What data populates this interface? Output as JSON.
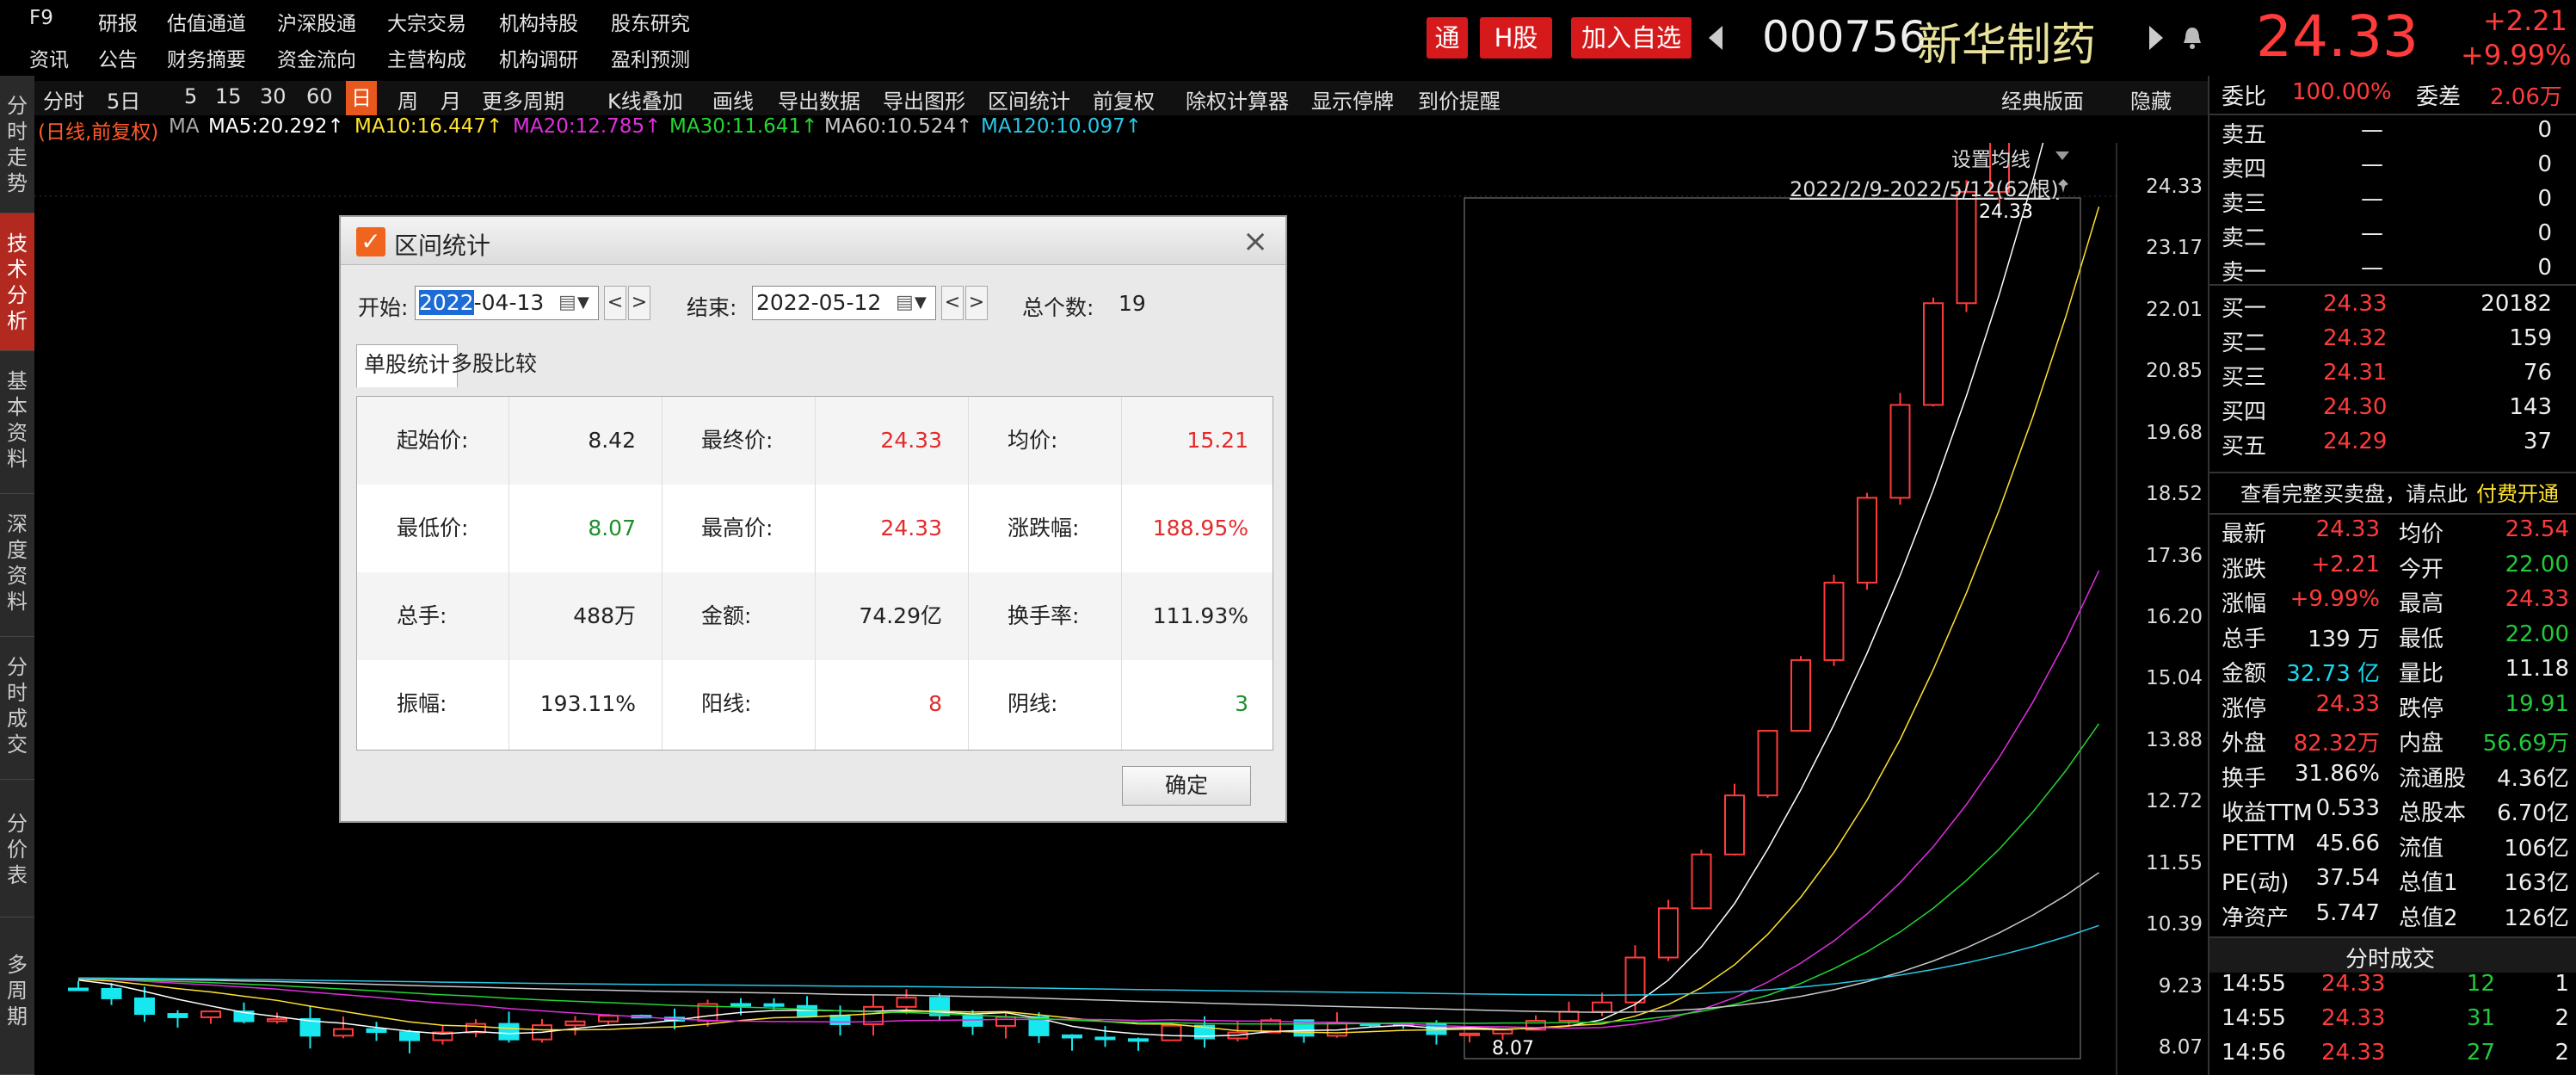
{
  "top_menu": {
    "row1": [
      "F9",
      "研报",
      "估值通道",
      "沪深股通",
      "大宗交易",
      "机构持股",
      "股东研究"
    ],
    "row2": [
      "资讯",
      "公告",
      "财务摘要",
      "资金流向",
      "主营构成",
      "机构调研",
      "盈利预测"
    ]
  },
  "header": {
    "tong_label": "通",
    "h_share_label": "H股",
    "add_watch_label": "加入自选",
    "code": "000756",
    "name": "新华制药",
    "price": "24.33",
    "change": "+2.21",
    "change_pct": "+9.99%",
    "prev_icon": "triangle-left-icon",
    "next_icon": "triangle-right-icon",
    "bell_icon": "bell-icon"
  },
  "left_tabs": [
    "分时走势",
    "技术分析",
    "基本资料",
    "深度资料",
    "分时成交",
    "分价表",
    "多周期"
  ],
  "toolbar": {
    "items": [
      "分时",
      "5日",
      "5",
      "15",
      "30",
      "60",
      "日",
      "周",
      "月",
      "更多周期",
      "K线叠加",
      "画线",
      "导出数据",
      "导出图形",
      "区间统计",
      "前复权",
      "除权计算器",
      "显示停牌",
      "到价提醒"
    ],
    "active": "日",
    "right_items": [
      "经典版面",
      "隐藏"
    ]
  },
  "ma_line": {
    "prefix": "(日线,前复权)",
    "ma": "MA",
    "ma5": "MA5:20.292↑",
    "ma10": "MA10:16.447↑",
    "ma20": "MA20:12.785↑",
    "ma30": "MA30:11.641↑",
    "ma60": "MA60:10.524↑",
    "ma120": "MA120:10.097↑"
  },
  "chart": {
    "set_ma_label": "设置均线",
    "range_label": "2022/2/9-2022/5/12(62根)",
    "high_label": "24.33",
    "low_label": "8.07",
    "price_axis": [
      "24.33",
      "23.17",
      "22.01",
      "20.85",
      "19.68",
      "18.52",
      "17.36",
      "16.20",
      "15.04",
      "13.88",
      "12.72",
      "11.55",
      "10.39",
      "9.23",
      "8.07"
    ],
    "colors": {
      "up": "#ff3b3b",
      "down": "#17e7ef",
      "ma5": "#ffffff",
      "ma10": "#ffe22e",
      "ma20": "#e02ee0",
      "ma30": "#22d633",
      "ma60": "#c8c8c8",
      "ma120": "#28c8e8"
    }
  },
  "dialog": {
    "title": "区间统计",
    "start_label": "开始:",
    "start_year": "2022",
    "start_rest": "-04-13",
    "end_label": "结束:",
    "end_value": "2022-05-12",
    "count_label": "总个数:",
    "count_value": "19",
    "tabs": [
      "单股统计",
      "多股比较"
    ],
    "rows": [
      [
        {
          "label": "起始价:",
          "value": "8.42",
          "color": "#222"
        },
        {
          "label": "最终价:",
          "value": "24.33",
          "color": "#e32b2b"
        },
        {
          "label": "均价:",
          "value": "15.21",
          "color": "#e32b2b"
        }
      ],
      [
        {
          "label": "最低价:",
          "value": "8.07",
          "color": "#1d8f2a"
        },
        {
          "label": "最高价:",
          "value": "24.33",
          "color": "#e32b2b"
        },
        {
          "label": "涨跌幅:",
          "value": "188.95%",
          "color": "#e32b2b"
        }
      ],
      [
        {
          "label": "总手:",
          "value": "488万",
          "color": "#222"
        },
        {
          "label": "金额:",
          "value": "74.29亿",
          "color": "#222"
        },
        {
          "label": "换手率:",
          "value": "111.93%",
          "color": "#222"
        }
      ],
      [
        {
          "label": "振幅:",
          "value": "193.11%",
          "color": "#222"
        },
        {
          "label": "阳线:",
          "value": "8",
          "color": "#e32b2b"
        },
        {
          "label": "阴线:",
          "value": "3",
          "color": "#1d8f2a"
        }
      ]
    ],
    "ok_label": "确定"
  },
  "order_book": {
    "weibi_label": "委比",
    "weibi_value": "100.00%",
    "weicha_label": "委差",
    "weicha_value": "2.06万",
    "sells": [
      {
        "label": "卖五",
        "price": "—",
        "vol": "0"
      },
      {
        "label": "卖四",
        "price": "—",
        "vol": "0"
      },
      {
        "label": "卖三",
        "price": "—",
        "vol": "0"
      },
      {
        "label": "卖二",
        "price": "—",
        "vol": "0"
      },
      {
        "label": "卖一",
        "price": "—",
        "vol": "0"
      }
    ],
    "buys": [
      {
        "label": "买一",
        "price": "24.33",
        "vol": "20182"
      },
      {
        "label": "买二",
        "price": "24.32",
        "vol": "159"
      },
      {
        "label": "买三",
        "price": "24.31",
        "vol": "76"
      },
      {
        "label": "买四",
        "price": "24.30",
        "vol": "143"
      },
      {
        "label": "买五",
        "price": "24.29",
        "vol": "37"
      }
    ],
    "full_book_text": "查看完整买卖盘，请点此",
    "paid_label": "付费开通"
  },
  "quote": [
    [
      {
        "l": "最新",
        "v": "24.33",
        "c": "red"
      },
      {
        "l": "均价",
        "v": "23.54",
        "c": "red"
      }
    ],
    [
      {
        "l": "涨跌",
        "v": "+2.21",
        "c": "red"
      },
      {
        "l": "今开",
        "v": "22.00",
        "c": "green"
      }
    ],
    [
      {
        "l": "涨幅",
        "v": "+9.99%",
        "c": "red"
      },
      {
        "l": "最高",
        "v": "24.33",
        "c": "red"
      }
    ],
    [
      {
        "l": "总手",
        "v": "139 万",
        "c": "white"
      },
      {
        "l": "最低",
        "v": "22.00",
        "c": "green"
      }
    ],
    [
      {
        "l": "金额",
        "v": "32.73 亿",
        "c": "cyan"
      },
      {
        "l": "量比",
        "v": "11.18",
        "c": "white"
      }
    ],
    [
      {
        "l": "涨停",
        "v": "24.33",
        "c": "red"
      },
      {
        "l": "跌停",
        "v": "19.91",
        "c": "green"
      }
    ],
    [
      {
        "l": "外盘",
        "v": "82.32万",
        "c": "red"
      },
      {
        "l": "内盘",
        "v": "56.69万",
        "c": "green"
      }
    ],
    [
      {
        "l": "换手",
        "v": "31.86%",
        "c": "white"
      },
      {
        "l": "流通股",
        "v": "4.36亿",
        "c": "white"
      }
    ],
    [
      {
        "l": "收益TTM",
        "v": "0.533",
        "c": "white"
      },
      {
        "l": "总股本",
        "v": "6.70亿",
        "c": "white"
      }
    ],
    [
      {
        "l": "PETTM",
        "v": "45.66",
        "c": "white"
      },
      {
        "l": "流值",
        "v": "106亿",
        "c": "white"
      }
    ],
    [
      {
        "l": "PE(动)",
        "v": "37.54",
        "c": "white"
      },
      {
        "l": "总值1",
        "v": "163亿",
        "c": "white"
      }
    ],
    [
      {
        "l": "净资产",
        "v": "5.747",
        "c": "white"
      },
      {
        "l": "总值2",
        "v": "126亿",
        "c": "white"
      }
    ]
  ],
  "ticks": {
    "title": "分时成交",
    "rows": [
      {
        "t": "14:55",
        "p": "24.33",
        "v": "12",
        "n": "1"
      },
      {
        "t": "14:55",
        "p": "24.33",
        "v": "31",
        "n": "2"
      },
      {
        "t": "14:56",
        "p": "24.33",
        "v": "27",
        "n": "2"
      }
    ]
  }
}
